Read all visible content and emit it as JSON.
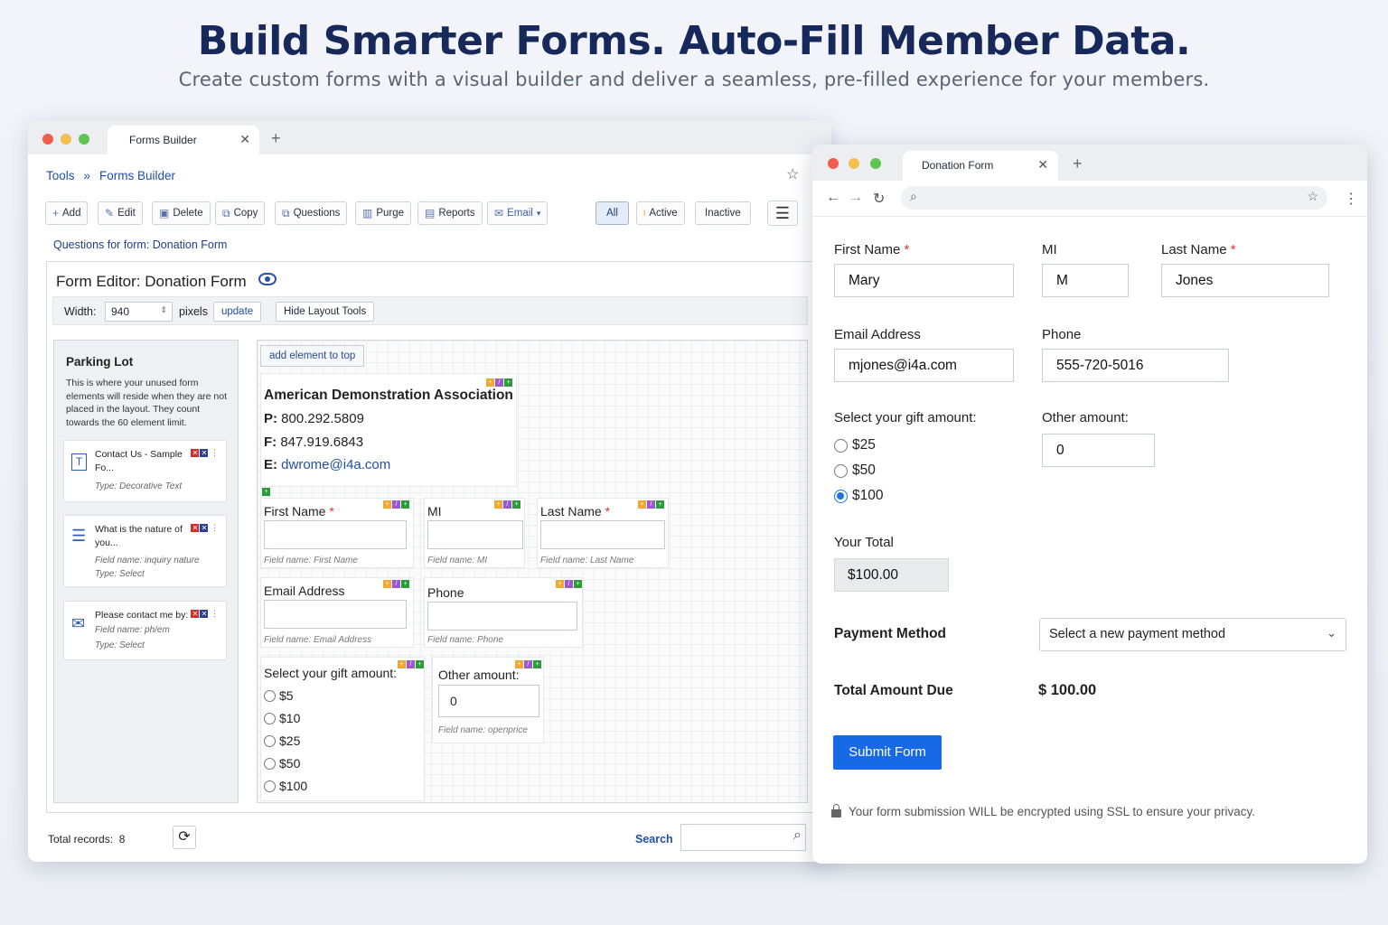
{
  "hero": {
    "title": "Build Smarter Forms. Auto-Fill Member Data.",
    "subtitle": "Create custom forms with a visual builder and deliver a seamless, pre-filled experience for your members."
  },
  "builder": {
    "tab_title": "Forms Builder",
    "breadcrumb": [
      "Tools",
      "»",
      "Forms Builder"
    ],
    "toolbar": [
      {
        "label": "Add",
        "icon": "plus-icon"
      },
      {
        "label": "Edit",
        "icon": "edit-icon"
      },
      {
        "label": "Delete",
        "icon": "delete-icon"
      },
      {
        "label": "Copy",
        "icon": "copy-icon"
      },
      {
        "label": "Questions",
        "icon": "questions-icon"
      },
      {
        "label": "Purge",
        "icon": "purge-icon"
      },
      {
        "label": "Reports",
        "icon": "reports-icon"
      },
      {
        "label": "Email",
        "icon": "email-icon"
      }
    ],
    "filters": [
      "All",
      "Active",
      "Inactive"
    ],
    "questions_link": "Questions for form: Donation Form",
    "editor_title": "Form Editor: Donation Form",
    "width_label": "Width:",
    "width_value": "940",
    "pixels_label": "pixels",
    "update_label": "update",
    "hide_layout_label": "Hide Layout Tools",
    "parking_lot": {
      "title": "Parking Lot",
      "description": "This is where your unused form elements will reside when they are not placed in the layout. They count towards the 60 element limit.",
      "items": [
        {
          "title": "Contact Us - Sample Fo...",
          "meta1": "Type: Decorative Text",
          "meta2": "",
          "icon": "text-icon"
        },
        {
          "title": "What is the nature of you...",
          "meta1": "Field name: inquiry nature",
          "meta2": "Type: Select",
          "icon": "list-icon"
        },
        {
          "title": "Please contact me by:",
          "meta1": "Field name: ph/em",
          "meta2": "Type: Select",
          "icon": "envelope-icon"
        }
      ]
    },
    "add_element_top": "add element to top",
    "org": {
      "name": "American Demonstration Association",
      "p_label": "P:",
      "phone": "800.292.5809",
      "f_label": "F:",
      "fax": "847.919.6843",
      "e_label": "E:",
      "email": "dwrome@i4a.com"
    },
    "fields": {
      "first_name": {
        "label": "First Name",
        "meta": "Field name: First Name"
      },
      "mi": {
        "label": "MI",
        "meta": "Field name: MI"
      },
      "last_name": {
        "label": "Last Name",
        "meta": "Field name: Last Name"
      },
      "email": {
        "label": "Email Address",
        "meta": "Field name: Email Address"
      },
      "phone": {
        "label": "Phone",
        "meta": "Field name: Phone"
      },
      "gift": {
        "label": "Select your gift amount:",
        "options": [
          "$5",
          "$10",
          "$25",
          "$50",
          "$100"
        ]
      },
      "other": {
        "label": "Other amount:",
        "value": "0",
        "meta": "Field name: openprice"
      }
    },
    "total_records_label": "Total records:",
    "total_records": "8",
    "search_label": "Search"
  },
  "donation": {
    "tab_title": "Donation Form",
    "first_name_label": "First Name",
    "first_name": "Mary",
    "mi_label": "MI",
    "mi": "M",
    "last_name_label": "Last Name",
    "last_name": "Jones",
    "email_label": "Email Address",
    "email": "mjones@i4a.com",
    "phone_label": "Phone",
    "phone": "555-720-5016",
    "gift_label": "Select your gift amount:",
    "gift_options": [
      "$25",
      "$50",
      "$100"
    ],
    "gift_selected": "$100",
    "other_label": "Other amount:",
    "other_value": "0",
    "total_label": "Your Total",
    "total_value": "$100.00",
    "payment_label": "Payment Method",
    "payment_placeholder": "Select a new payment method",
    "due_label": "Total Amount Due",
    "due_value": "$ 100.00",
    "submit_label": "Submit Form",
    "ssl_note": "Your form submission WILL be encrypted using SSL to ensure your privacy."
  },
  "colors": {
    "accent": "#1769e6",
    "title": "#16295a",
    "link": "#1f4fa8"
  }
}
